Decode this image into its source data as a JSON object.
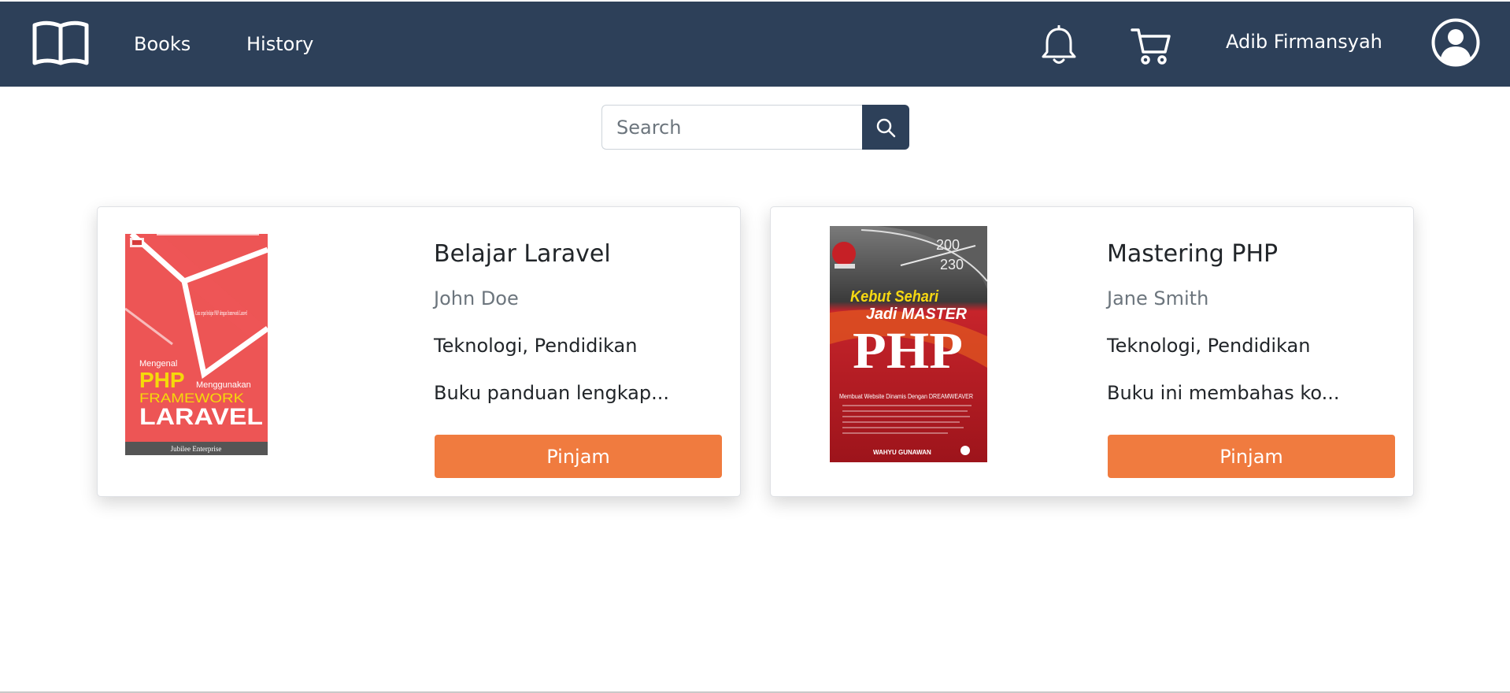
{
  "navbar": {
    "brand_icon": "open-book-icon",
    "links": {
      "books": "Books",
      "history": "History"
    },
    "notification_icon": "bell-icon",
    "cart_icon": "cart-icon",
    "username": "Adib Firmansyah",
    "avatar_icon": "user-circle-icon",
    "background": "#2d4059"
  },
  "search": {
    "placeholder": "Search",
    "value": "",
    "button_icon": "search-icon"
  },
  "accent": "#f07b3f",
  "books": [
    {
      "title": "Belajar Laravel",
      "author": "John Doe",
      "genres": "Teknologi, Pendidikan",
      "description": "Buku panduan lengkap...",
      "button": "Pinjam",
      "cover": {
        "tagline": "Cara cepat belajar PHP dengan framework Laravel",
        "line1": "Mengenal",
        "line2": "PHP",
        "line3": "Menggunakan",
        "line4": "FRAMEWORK",
        "line5": "LARAVEL",
        "publisher": "Jubilee Enterprise"
      }
    },
    {
      "title": "Mastering PHP",
      "author": "Jane Smith",
      "genres": "Teknologi, Pendidikan",
      "description": "Buku ini membahas ko...",
      "button": "Pinjam",
      "cover": {
        "speed_1": "200",
        "speed_2": "230",
        "line1": "Kebut Sehari",
        "line2": "Jadi MASTER",
        "line3": "PHP",
        "subtitle": "Membuat Website Dinamis Dengan DREAMWEAVER",
        "author": "WAHYU GUNAWAN"
      }
    }
  ]
}
